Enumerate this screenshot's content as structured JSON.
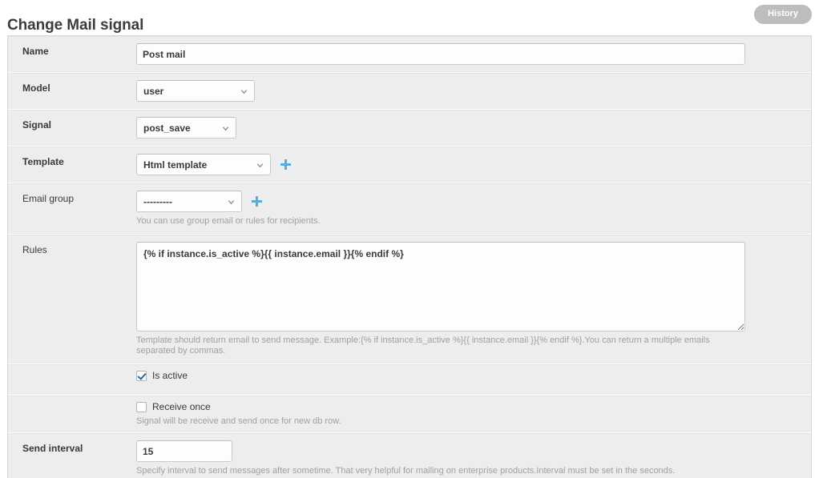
{
  "header": {
    "title": "Change Mail signal",
    "history_label": "History"
  },
  "form": {
    "name": {
      "label": "Name",
      "value": "Post mail"
    },
    "model": {
      "label": "Model",
      "value": "user"
    },
    "signal": {
      "label": "Signal",
      "value": "post_save"
    },
    "template": {
      "label": "Template",
      "value": "Html template",
      "add_label": "+"
    },
    "email_group": {
      "label": "Email group",
      "value": "---------",
      "add_label": "+",
      "help": "You can use group email or rules for recipients."
    },
    "rules": {
      "label": "Rules",
      "value": "{% if instance.is_active %}{{ instance.email }}{% endif %}",
      "help": "Template should return email to send message. Example:{% if instance.is_active %}{{ instance.email }}{% endif %}.You can return a multiple emails separated by commas."
    },
    "is_active": {
      "label": "Is active",
      "checked": true
    },
    "receive_once": {
      "label": "Receive once",
      "checked": false,
      "help": "Signal will be receive and send once for new db row."
    },
    "send_interval": {
      "label": "Send interval",
      "value": "15",
      "help": "Specify interval to send messages after sometime. That very helpful for mailing on enterprise products.Interval must be set in the seconds."
    }
  },
  "colors": {
    "accent_blue": "#5bacd6",
    "row_bg": "#ededed",
    "history_bg": "#bdbdbd",
    "checkbox_check": "#2b6a9b"
  }
}
